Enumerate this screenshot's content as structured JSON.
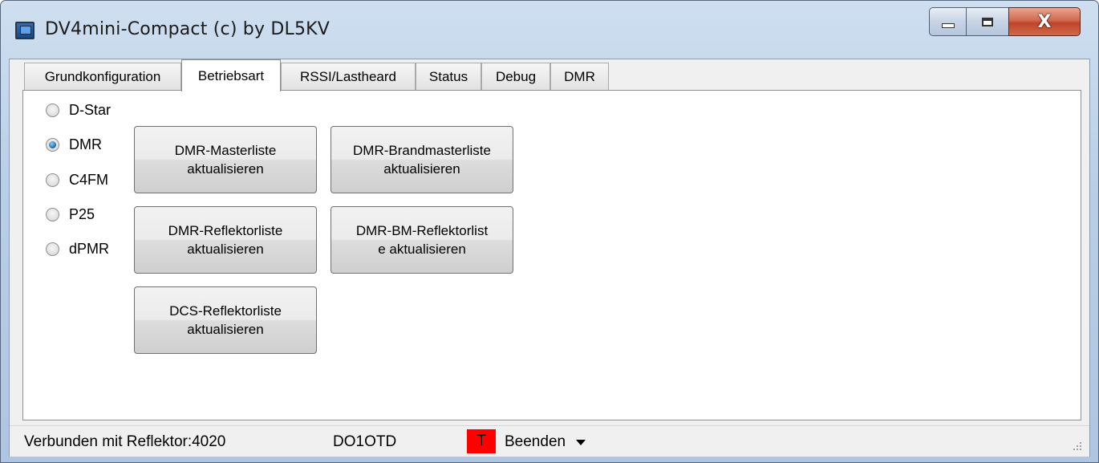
{
  "window": {
    "title": "DV4mini-Compact (c) by DL5KV",
    "controls": {
      "close_glyph": "X"
    }
  },
  "tabs": [
    {
      "label": "Grundkonfiguration",
      "active": false
    },
    {
      "label": "Betriebsart",
      "active": true
    },
    {
      "label": "RSSI/Lastheard",
      "active": false
    },
    {
      "label": "Status",
      "active": false
    },
    {
      "label": "Debug",
      "active": false
    },
    {
      "label": "DMR",
      "active": false
    }
  ],
  "modes": [
    {
      "label": "D-Star",
      "checked": false
    },
    {
      "label": "DMR",
      "checked": true
    },
    {
      "label": "C4FM",
      "checked": false
    },
    {
      "label": "P25",
      "checked": false
    },
    {
      "label": "dPMR",
      "checked": false
    }
  ],
  "buttons": {
    "dmr_masterliste": "DMR-Masterliste\naktualisieren",
    "dmr_brandmasterliste": "DMR-Brandmasterliste\naktualisieren",
    "dmr_reflektorliste": "DMR-Reflektorliste\naktualisieren",
    "dmr_bm_reflektorliste": "DMR-BM-Reflektorlist\ne aktualisieren",
    "dcs_reflektorliste": "DCS-Reflektorliste\naktualisieren"
  },
  "statusbar": {
    "connection": "Verbunden mit Reflektor:4020",
    "callsign": "DO1OTD",
    "indicator": "T",
    "indicator_color": "#ff0000",
    "exit_menu": "Beenden"
  }
}
